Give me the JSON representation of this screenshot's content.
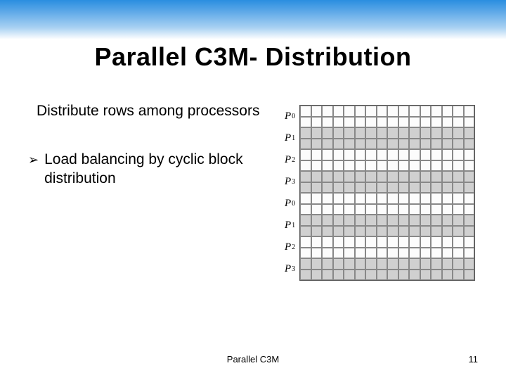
{
  "slide": {
    "title": "Parallel C3M- Distribution",
    "body_text_1": "Distribute rows among processors",
    "bullet_1": "Load balancing by cyclic block distribution",
    "footer_title": "Parallel C3M",
    "page_number": "11"
  },
  "diagram": {
    "row_labels": [
      "P₀",
      "P₁",
      "P₂",
      "P₃",
      "P₀",
      "P₁",
      "P₂",
      "P₃"
    ],
    "cols": 16,
    "block_rows": 8,
    "rows_per_block": 2
  }
}
